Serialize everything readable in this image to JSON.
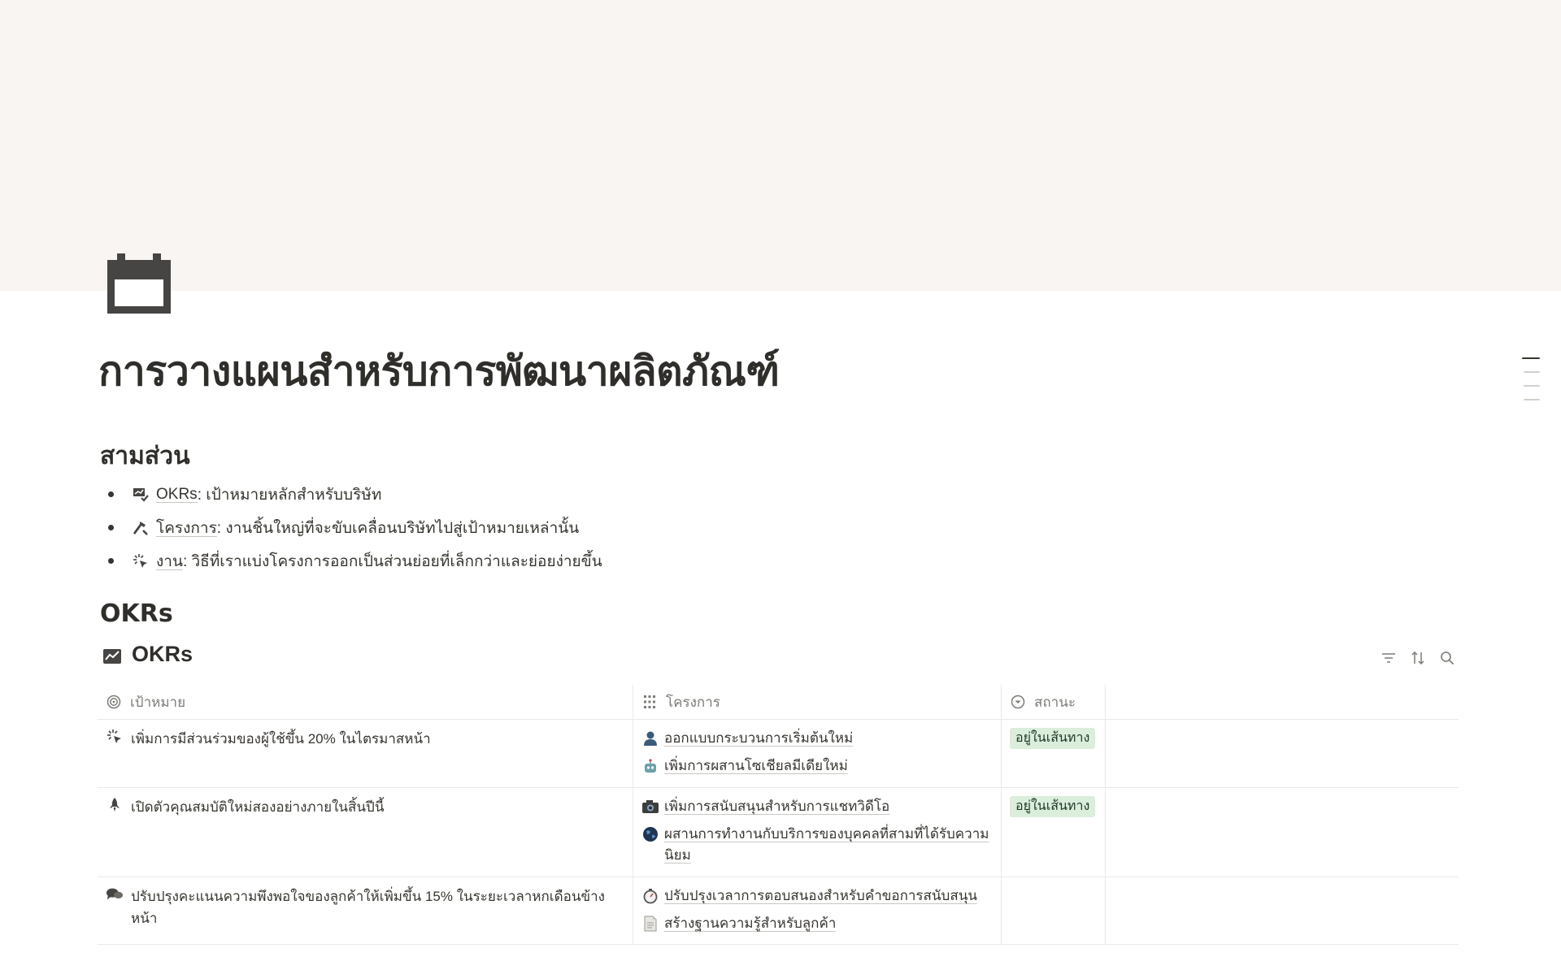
{
  "page": {
    "title": "การวางแผนสำหรับการพัฒนาผลิตภัณฑ์",
    "icon": "calendar-icon"
  },
  "section_three": {
    "heading": "สามส่วน",
    "items": [
      {
        "icon": "chart-check-icon",
        "link": "OKRs",
        "text": ": เป้าหมายหลักสำหรับบริษัท"
      },
      {
        "icon": "hammer-icon",
        "link": "โครงการ",
        "text": ": งานชิ้นใหญ่ที่จะขับเคลื่อนบริษัทไปสู่เป้าหมายเหล่านั้น"
      },
      {
        "icon": "sparkle-click-icon",
        "link": "งาน",
        "text": ": วิธีที่เราแบ่งโครงการออกเป็นส่วนย่อยที่เล็กกว่าและย่อยง่ายขึ้น"
      }
    ]
  },
  "section_okrs": {
    "heading": "OKRs"
  },
  "database": {
    "title": "OKRs",
    "icon": "chart-line-icon",
    "tools": [
      "filter-icon",
      "sort-icon",
      "search-icon"
    ],
    "columns": [
      {
        "label": "เป้าหมาย",
        "icon": "target-icon"
      },
      {
        "label": "โครงการ",
        "icon": "grid-icon"
      },
      {
        "label": "สถานะ",
        "icon": "status-icon"
      }
    ],
    "rows": [
      {
        "icon": "sparkle-click-icon",
        "goal": "เพิ่มการมีส่วนร่วมของผู้ใช้ขึ้น 20% ในไตรมาสหน้า",
        "projects": [
          {
            "icon": "person-icon",
            "label": "ออกแบบกระบวนการเริ่มต้นใหม่"
          },
          {
            "icon": "robot-icon",
            "label": "เพิ่มการผสานโซเชียลมีเดียใหม่"
          }
        ],
        "status": "อยู่ในเส้นทาง"
      },
      {
        "icon": "rocket-icon",
        "goal": "เปิดตัวคุณสมบัติใหม่สองอย่างภายในสิ้นปีนี้",
        "projects": [
          {
            "icon": "camera-icon",
            "label": "เพิ่มการสนับสนุนสำหรับการแชทวิดีโอ"
          },
          {
            "icon": "globe-icon",
            "label": "ผสานการทำงานกับบริการของบุคคลที่สามที่ได้รับความนิยม"
          }
        ],
        "status": "อยู่ในเส้นทาง"
      },
      {
        "icon": "chat-bubbles-icon",
        "goal": "ปรับปรุงคะแนนความพึงพอใจของลูกค้าให้เพิ่มขึ้น 15% ในระยะเวลาหกเดือนข้างหน้า",
        "projects": [
          {
            "icon": "stopwatch-icon",
            "label": "ปรับปรุงเวลาการตอบสนองสำหรับคำขอการสนับสนุน"
          },
          {
            "icon": "document-icon",
            "label": "สร้างฐานความรู้สำหรับลูกค้า"
          }
        ],
        "status": ""
      }
    ]
  },
  "colors": {
    "cover": "#f8f5f2",
    "text": "#37352f",
    "badge_bg": "#dbeddb",
    "badge_text": "#1c3829"
  }
}
